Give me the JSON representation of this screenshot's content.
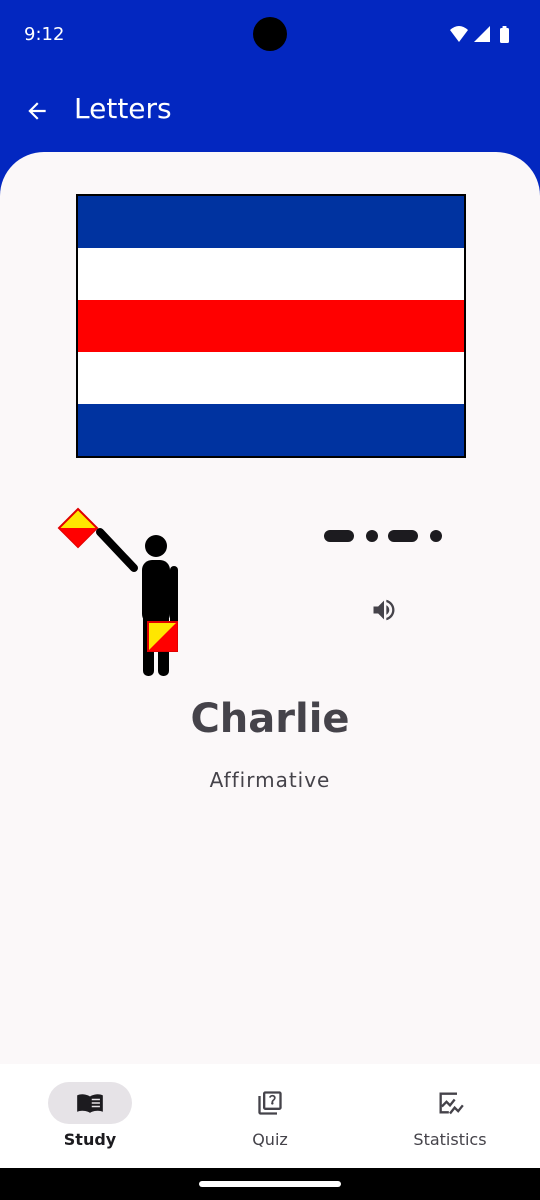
{
  "status_bar": {
    "time": "9:12",
    "icons": [
      "wifi-icon",
      "cellular-signal-icon",
      "battery-icon"
    ]
  },
  "app_bar": {
    "title": "Letters",
    "back_icon": "arrow-back-icon"
  },
  "card": {
    "flag": {
      "name": "charlie-flag",
      "stripes": [
        "#0033a0",
        "#ffffff",
        "#ff0000",
        "#ffffff",
        "#0033a0"
      ]
    },
    "semaphore_icon": "semaphore-figure-icon",
    "morse_code": [
      "dash",
      "dot",
      "dash",
      "dot"
    ],
    "sound_icon": "volume-icon",
    "name": "Charlie",
    "meaning": "Affirmative"
  },
  "bottom_nav": {
    "items": [
      {
        "label": "Study",
        "icon": "book-icon",
        "active": true
      },
      {
        "label": "Quiz",
        "icon": "quiz-icon",
        "active": false
      },
      {
        "label": "Statistics",
        "icon": "statistics-icon",
        "active": false
      }
    ]
  },
  "colors": {
    "primary": "#0327c0",
    "surface": "#fbf8f9",
    "nav_indicator": "#e6e3e7",
    "text": "#45434a"
  }
}
